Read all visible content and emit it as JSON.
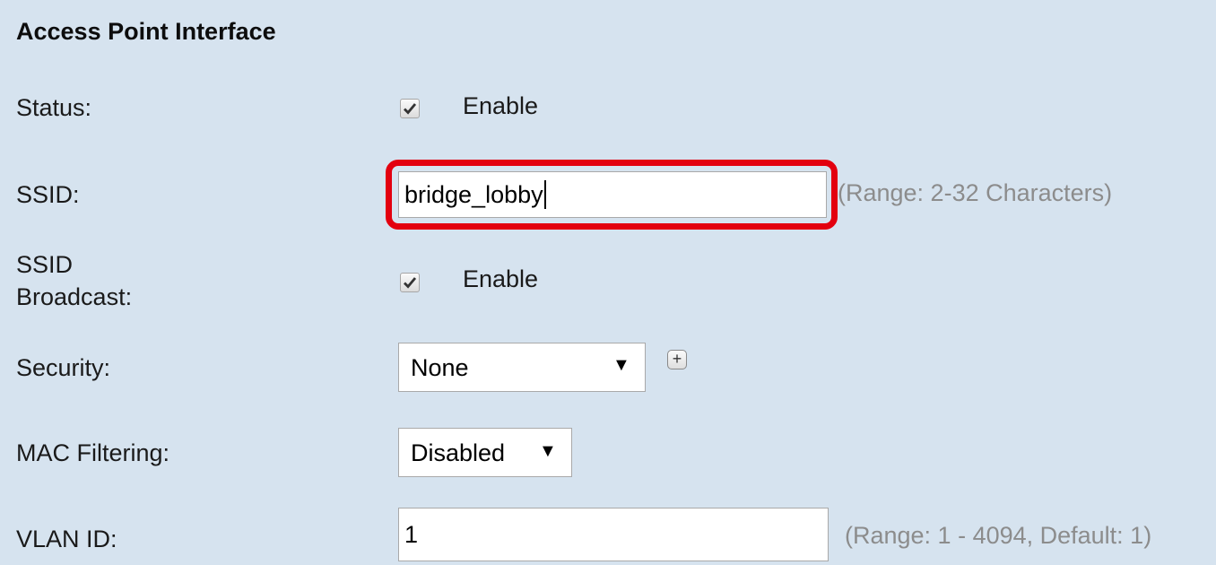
{
  "section": {
    "title": "Access Point Interface"
  },
  "status": {
    "label": "Status:",
    "checked": true,
    "option_label": "Enable"
  },
  "ssid": {
    "label": "SSID:",
    "value": "bridge_lobby",
    "hint": "(Range: 2-32 Characters)"
  },
  "ssid_broadcast": {
    "label_line1": "SSID",
    "label_line2": "Broadcast:",
    "checked": true,
    "option_label": "Enable"
  },
  "security": {
    "label": "Security:",
    "selected": "None",
    "plus_glyph": "+"
  },
  "mac_filtering": {
    "label": "MAC Filtering:",
    "selected": "Disabled"
  },
  "vlan": {
    "label": "VLAN ID:",
    "value": "1",
    "hint": "(Range: 1 - 4094, Default: 1)"
  },
  "colors": {
    "panel_bg": "#d6e3ef",
    "highlight": "#e3000f",
    "hint_text": "#8c8c8c"
  },
  "icons": {
    "checkbox_check": "checkmark-icon",
    "dropdown": "dropdown-arrow-icon",
    "expand": "plus-icon"
  },
  "glyphs": {
    "dropdown_arrow": "▼"
  }
}
